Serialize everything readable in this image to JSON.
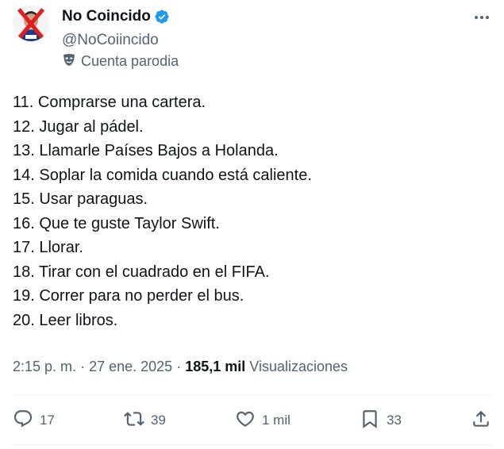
{
  "user": {
    "display_name": "No Coincido",
    "handle": "@NoCoiincido",
    "parody_label": "Cuenta parodia"
  },
  "icons": {
    "verified": "verified-badge-icon",
    "more": "more-options-icon",
    "parody": "parody-mask-icon",
    "reply": "reply-icon",
    "retweet": "retweet-icon",
    "like": "like-icon",
    "bookmark": "bookmark-icon",
    "share": "share-icon"
  },
  "colors": {
    "verified_blue": "#1d9bf0",
    "secondary_text": "#536471",
    "primary_text": "#0f1419",
    "avatar_cross": "#e0201c"
  },
  "tweet": {
    "lines": [
      "11. Comprarse una cartera.",
      "12. Jugar al pádel.",
      "13. Llamarle Países Bajos a Holanda.",
      "14. Soplar la comida cuando está caliente.",
      "15. Usar paraguas.",
      "16. Que te guste Taylor Swift.",
      "17. Llorar.",
      "18. Tirar con el cuadrado en el FIFA.",
      "19. Correr para no perder el bus.",
      "20. Leer libros."
    ],
    "time": "2:15 p. m.",
    "separator": "·",
    "date": "27 ene. 2025",
    "views_count": "185,1 mil",
    "views_label": "Visualizaciones"
  },
  "actions": {
    "replies": "17",
    "retweets": "39",
    "likes": "1 mil",
    "bookmarks": "33"
  }
}
